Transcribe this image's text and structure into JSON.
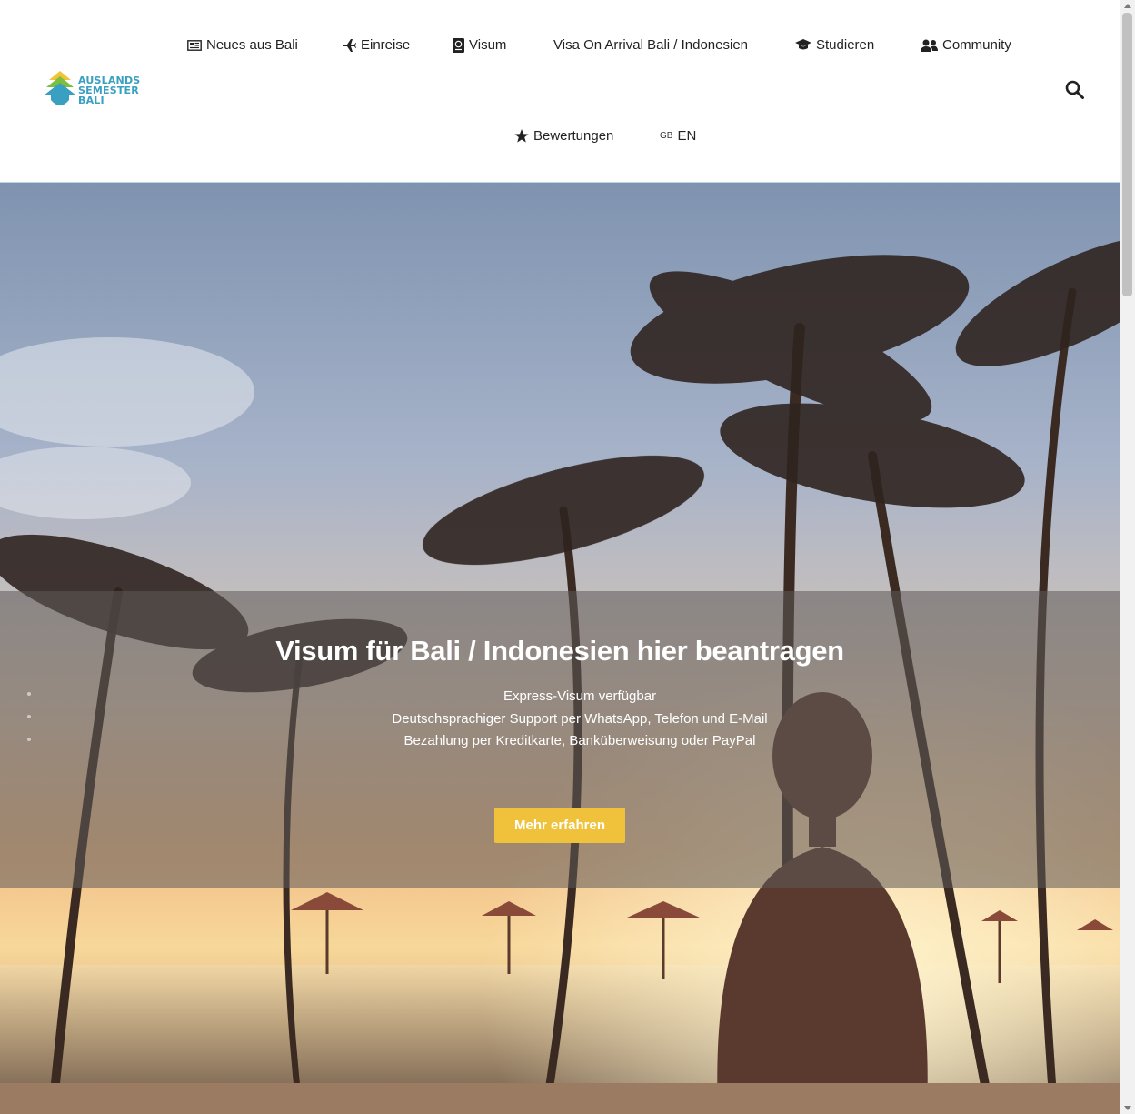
{
  "brand": {
    "logo_lines": [
      "AUSLANDS",
      "SEMESTER",
      "BALI"
    ],
    "logo_color": "#3aa0c2"
  },
  "nav": {
    "items": [
      {
        "label": "Neues aus Bali",
        "icon": "newspaper-icon"
      },
      {
        "label": "Einreise",
        "icon": "plane-icon"
      },
      {
        "label": "Visum",
        "icon": "passport-icon"
      },
      {
        "label": "Visa On Arrival Bali / Indonesien",
        "icon": ""
      },
      {
        "label": "Studieren",
        "icon": "graduation-cap-icon"
      },
      {
        "label": "Community",
        "icon": "users-icon"
      },
      {
        "label": "Bewertungen",
        "icon": "star-icon"
      },
      {
        "label": "EN",
        "icon": "gb-flag-icon",
        "prefix": "GB"
      }
    ],
    "search_icon": "search-icon"
  },
  "hero": {
    "title": "Visum für Bali / Indonesien hier beantragen",
    "lines": [
      "Express-Visum verfügbar",
      "Deutschsprachiger Support per WhatsApp, Telefon und E-Mail",
      "Bezahlung per Kreditkarte, Banküberweisung oder PayPal"
    ],
    "cta_label": "Mehr erfahren",
    "cta_color": "#f0c23b"
  }
}
